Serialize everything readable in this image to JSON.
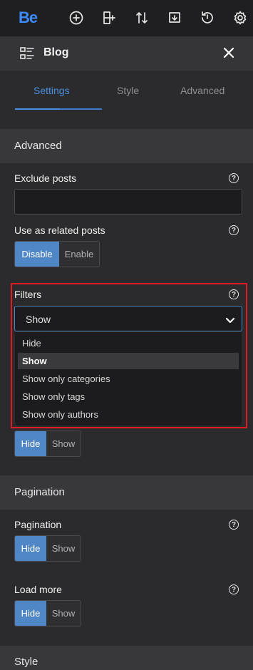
{
  "topbar": {
    "logo": "Be",
    "icons": [
      "plus-circle-icon",
      "add-section-icon",
      "sort-arrows-icon",
      "download-icon",
      "history-icon",
      "gear-icon"
    ]
  },
  "header": {
    "title": "Blog",
    "icon": "list-icon",
    "close_icon": "close-icon"
  },
  "tabs": [
    {
      "label": "Settings",
      "active": true
    },
    {
      "label": "Style",
      "active": false
    },
    {
      "label": "Advanced",
      "active": false
    }
  ],
  "sections": {
    "advanced": "Advanced",
    "pagination": "Pagination",
    "style": "Style"
  },
  "fields": {
    "exclude_posts": {
      "label": "Exclude posts",
      "value": ""
    },
    "related_posts": {
      "label": "Use as related posts",
      "options": [
        "Disable",
        "Enable"
      ],
      "selected": "Disable"
    },
    "filters": {
      "label": "Filters",
      "value": "Show",
      "options": [
        "Hide",
        "Show",
        "Show only categories",
        "Show only tags",
        "Show only authors"
      ]
    },
    "hidden_toggle": {
      "options": [
        "Hide",
        "Show"
      ],
      "selected": "Hide"
    },
    "pagination": {
      "label": "Pagination",
      "options": [
        "Hide",
        "Show"
      ],
      "selected": "Hide"
    },
    "load_more": {
      "label": "Load more",
      "options": [
        "Hide",
        "Show"
      ],
      "selected": "Hide"
    }
  },
  "help_glyph": "?",
  "colors": {
    "accent": "#4f86c6",
    "brand": "#3d8bff",
    "highlight": "#e01b24"
  }
}
